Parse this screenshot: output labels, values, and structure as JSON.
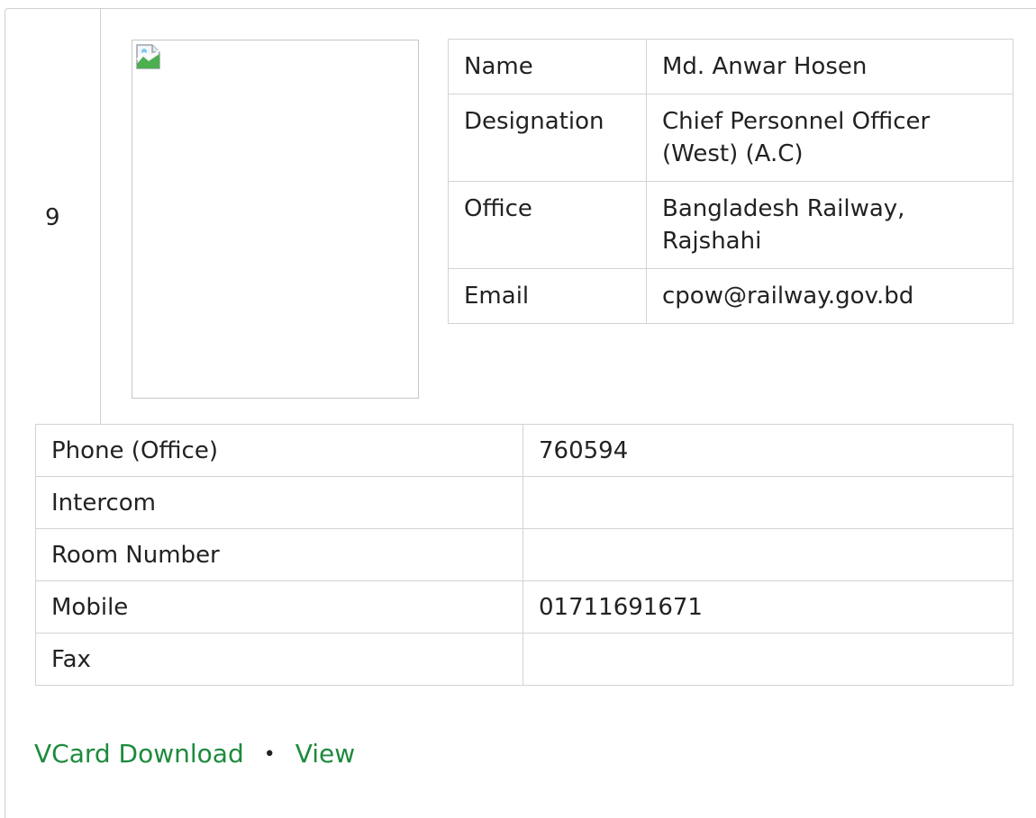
{
  "record": {
    "serial": "9"
  },
  "profile": {
    "photo_icon": "broken-image-icon",
    "rows": [
      {
        "label": "Name",
        "value": "Md. Anwar Hosen"
      },
      {
        "label": "Designation",
        "value": "Chief Personnel Officer (West) (A.C)"
      },
      {
        "label": "Office",
        "value": "Bangladesh Railway, Rajshahi"
      },
      {
        "label": "Email",
        "value": "cpow@railway.gov.bd"
      }
    ]
  },
  "contact": {
    "rows": [
      {
        "label": "Phone (Office)",
        "value": "760594"
      },
      {
        "label": "Intercom",
        "value": ""
      },
      {
        "label": "Room Number",
        "value": ""
      },
      {
        "label": "Mobile",
        "value": "01711691671"
      },
      {
        "label": "Fax",
        "value": ""
      }
    ]
  },
  "links": {
    "vcard_label": "VCard Download",
    "separator": "•",
    "view_label": "View",
    "color": "#1d8a3c"
  }
}
